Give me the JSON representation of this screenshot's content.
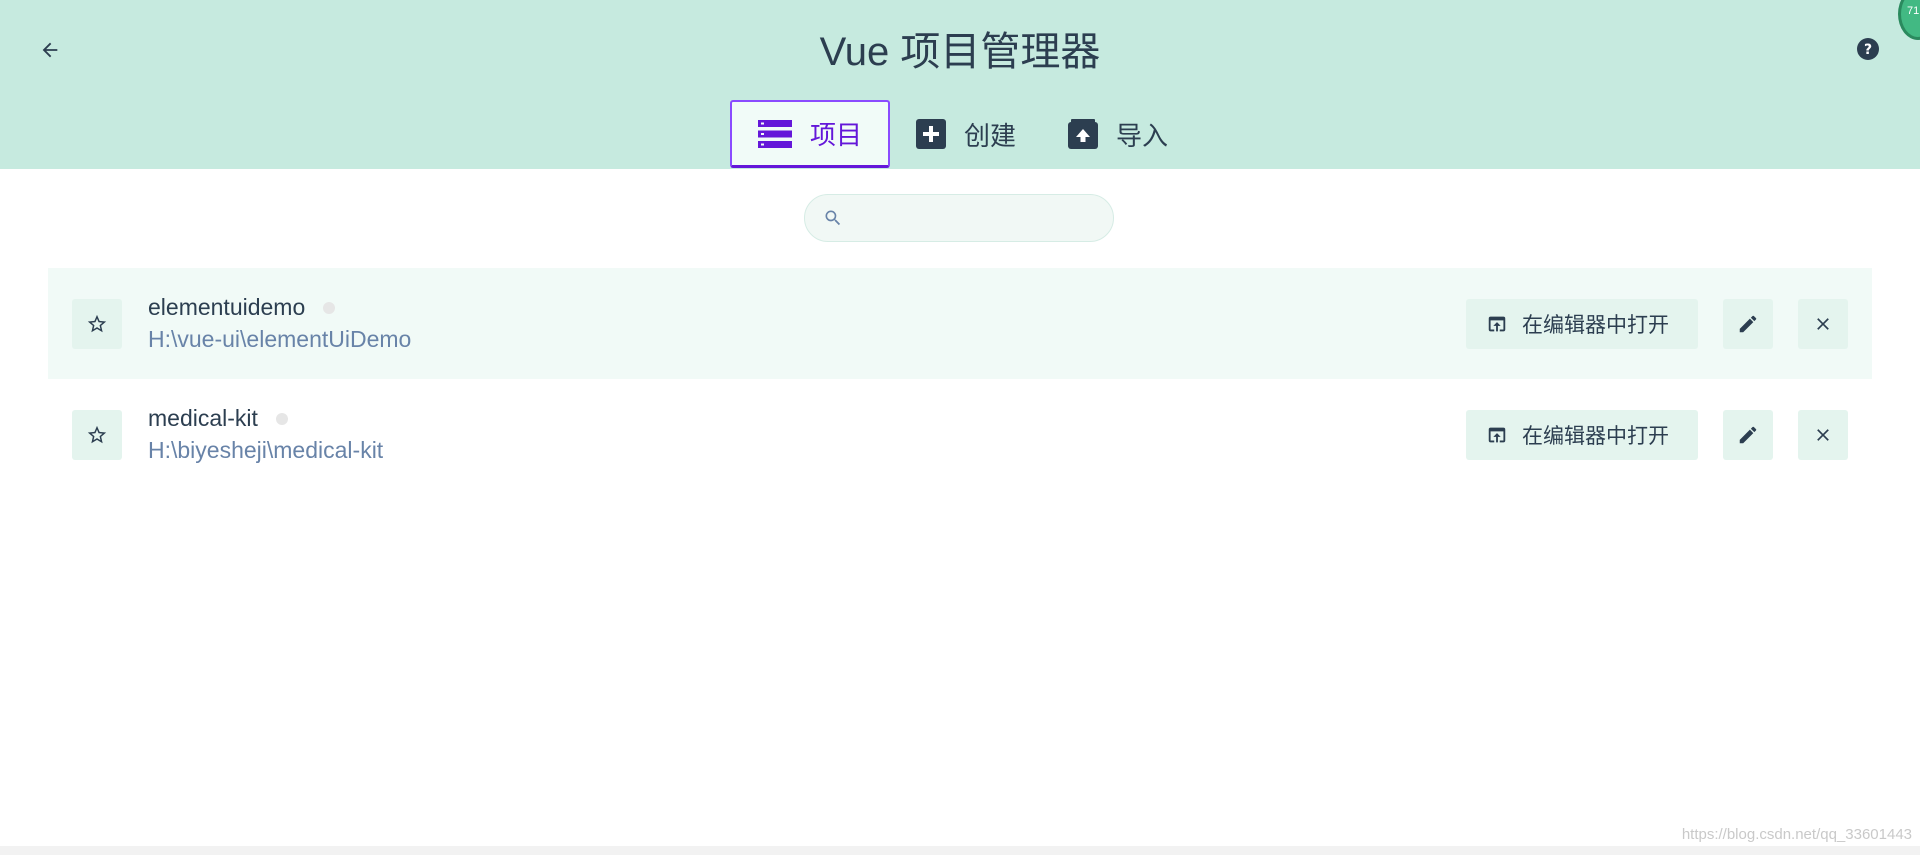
{
  "header": {
    "title": "Vue 项目管理器",
    "badge": "71",
    "colors": {
      "background": "#c6eadf",
      "accent": "#6417d9",
      "text": "#2c3e50"
    },
    "tabs": [
      {
        "label": "项目",
        "icon": "list-icon",
        "active": true
      },
      {
        "label": "创建",
        "icon": "plus-box-icon",
        "active": false
      },
      {
        "label": "导入",
        "icon": "unarchive-icon",
        "active": false
      }
    ]
  },
  "search": {
    "value": "",
    "placeholder": ""
  },
  "projects": [
    {
      "name": "elementuidemo",
      "path": "H:\\vue-ui\\elementUiDemo",
      "open_label": "在编辑器中打开",
      "highlighted": true
    },
    {
      "name": "medical-kit",
      "path": "H:\\biyesheji\\medical-kit",
      "open_label": "在编辑器中打开",
      "highlighted": false
    }
  ],
  "watermark": "https://blog.csdn.net/qq_33601443"
}
